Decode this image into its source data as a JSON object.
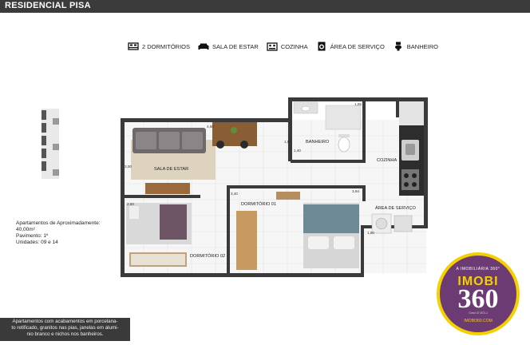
{
  "header": {
    "title": "RESIDENCIAL PISA"
  },
  "legend": [
    {
      "icon": "bed-icon",
      "label": "2 DORMITÓRIOS"
    },
    {
      "icon": "sofa-icon",
      "label": "SALA DE ESTAR"
    },
    {
      "icon": "stove-icon",
      "label": "COZINHA"
    },
    {
      "icon": "washing-machine-icon",
      "label": "ÁREA DE SERVIÇO"
    },
    {
      "icon": "toilet-icon",
      "label": "BANHEIRO"
    }
  ],
  "plan": {
    "rooms": {
      "sala": "SALA DE ESTAR",
      "banheiro": "BANHEIRO",
      "cozinha": "COZINHA",
      "dorm1": "DORMITÓRIO 01",
      "dorm2": "DORMITÓRIO 02",
      "servico": "ÁREA DE SERVIÇO"
    },
    "dims": {
      "d1": "4,60",
      "d2": "3,00",
      "d3": "1,55",
      "d4": "1,50",
      "d5": "1,40",
      "d6": "3,94",
      "d7": "2,50",
      "d8": "1,50",
      "d9": "3,40"
    }
  },
  "info": {
    "line1": "Apartamentos de Aproximadamente:",
    "line2": "40,00m²",
    "line3": "Pavimento: 1º",
    "line4": "Unidades: 09 e 14"
  },
  "note": {
    "line1": "Apartamentos com acabamentos em porcelana-",
    "line2": "to retificado, granitos nas pias, janelas em alumi-",
    "line3": "nio branco e nichos nos banheiros."
  },
  "badge": {
    "top_text": "A IMOBILIÁRIA 360°",
    "brand": "IMOBI",
    "number": "360",
    "creci": "Creci 37.872-J",
    "url": "IMOBI360.COM"
  }
}
